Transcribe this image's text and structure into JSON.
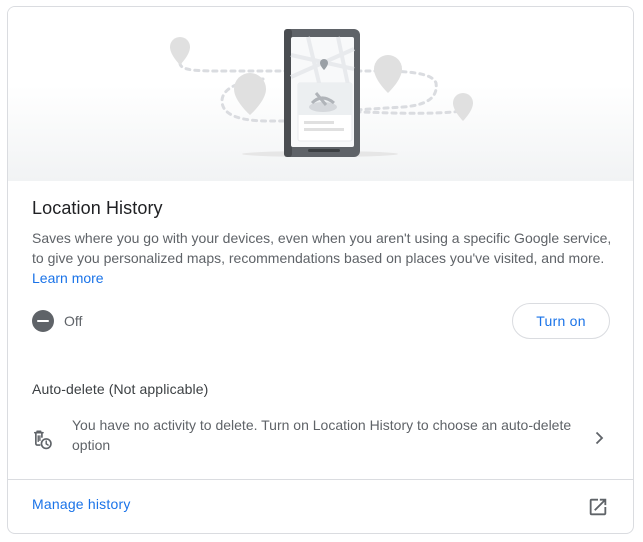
{
  "location_history": {
    "title": "Location History",
    "description": "Saves where you go with your devices, even when you aren't using a specific Google service, to give you personalized maps, recommendations based on places you've visited, and more.",
    "learn_more": "Learn more",
    "status": "Off",
    "turn_on_label": "Turn on"
  },
  "auto_delete": {
    "heading": "Auto-delete (Not applicable)",
    "message": "You have no activity to delete. Turn on Location History to choose an auto-delete option"
  },
  "footer": {
    "manage_history_label": "Manage history"
  },
  "icons": {
    "status": "do-not-disturb-icon",
    "auto_delete": "auto-delete-icon",
    "chevron": "chevron-right-icon",
    "open_external": "open-in-new-icon"
  },
  "colors": {
    "accent": "#1a73e8",
    "text_primary": "#202124",
    "text_secondary": "#5f6368",
    "border": "#dadce0"
  }
}
